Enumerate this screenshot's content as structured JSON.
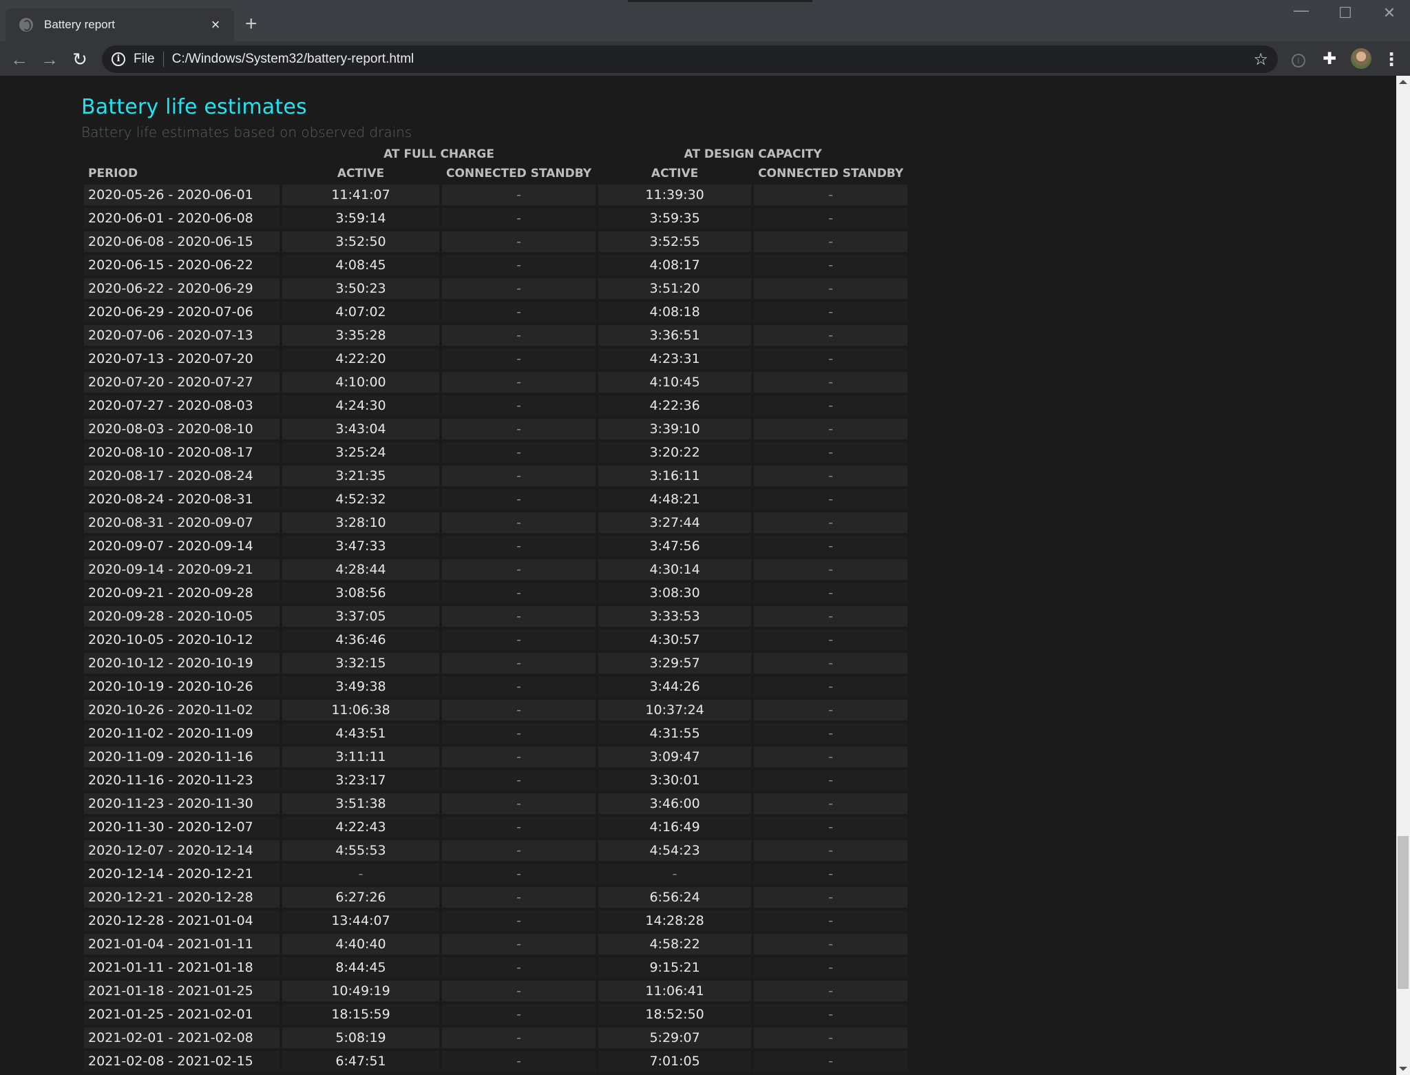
{
  "browser": {
    "tab_title": "Battery report",
    "tab_close": "×",
    "new_tab": "+",
    "window_controls": {
      "minimize": "—",
      "maximize": "☐",
      "close": "✕"
    },
    "nav": {
      "back": "←",
      "forward": "→",
      "reload": "↻"
    },
    "address": {
      "scheme_label": "File",
      "url": "C:/Windows/System32/battery-report.html",
      "info": "i"
    },
    "icons": {
      "star": "☆",
      "extension": "i",
      "puzzle": "✚",
      "menu": "⋮"
    }
  },
  "section": {
    "title": "Battery life estimates",
    "subtitle": "Battery life estimates based on observed drains"
  },
  "table": {
    "group_headers": [
      "AT FULL CHARGE",
      "AT DESIGN CAPACITY"
    ],
    "columns": [
      "PERIOD",
      "ACTIVE",
      "CONNECTED STANDBY",
      "ACTIVE",
      "CONNECTED STANDBY"
    ],
    "rows": [
      [
        "2020-05-26 - 2020-06-01",
        "11:41:07",
        "-",
        "11:39:30",
        "-"
      ],
      [
        "2020-06-01 - 2020-06-08",
        "3:59:14",
        "-",
        "3:59:35",
        "-"
      ],
      [
        "2020-06-08 - 2020-06-15",
        "3:52:50",
        "-",
        "3:52:55",
        "-"
      ],
      [
        "2020-06-15 - 2020-06-22",
        "4:08:45",
        "-",
        "4:08:17",
        "-"
      ],
      [
        "2020-06-22 - 2020-06-29",
        "3:50:23",
        "-",
        "3:51:20",
        "-"
      ],
      [
        "2020-06-29 - 2020-07-06",
        "4:07:02",
        "-",
        "4:08:18",
        "-"
      ],
      [
        "2020-07-06 - 2020-07-13",
        "3:35:28",
        "-",
        "3:36:51",
        "-"
      ],
      [
        "2020-07-13 - 2020-07-20",
        "4:22:20",
        "-",
        "4:23:31",
        "-"
      ],
      [
        "2020-07-20 - 2020-07-27",
        "4:10:00",
        "-",
        "4:10:45",
        "-"
      ],
      [
        "2020-07-27 - 2020-08-03",
        "4:24:30",
        "-",
        "4:22:36",
        "-"
      ],
      [
        "2020-08-03 - 2020-08-10",
        "3:43:04",
        "-",
        "3:39:10",
        "-"
      ],
      [
        "2020-08-10 - 2020-08-17",
        "3:25:24",
        "-",
        "3:20:22",
        "-"
      ],
      [
        "2020-08-17 - 2020-08-24",
        "3:21:35",
        "-",
        "3:16:11",
        "-"
      ],
      [
        "2020-08-24 - 2020-08-31",
        "4:52:32",
        "-",
        "4:48:21",
        "-"
      ],
      [
        "2020-08-31 - 2020-09-07",
        "3:28:10",
        "-",
        "3:27:44",
        "-"
      ],
      [
        "2020-09-07 - 2020-09-14",
        "3:47:33",
        "-",
        "3:47:56",
        "-"
      ],
      [
        "2020-09-14 - 2020-09-21",
        "4:28:44",
        "-",
        "4:30:14",
        "-"
      ],
      [
        "2020-09-21 - 2020-09-28",
        "3:08:56",
        "-",
        "3:08:30",
        "-"
      ],
      [
        "2020-09-28 - 2020-10-05",
        "3:37:05",
        "-",
        "3:33:53",
        "-"
      ],
      [
        "2020-10-05 - 2020-10-12",
        "4:36:46",
        "-",
        "4:30:57",
        "-"
      ],
      [
        "2020-10-12 - 2020-10-19",
        "3:32:15",
        "-",
        "3:29:57",
        "-"
      ],
      [
        "2020-10-19 - 2020-10-26",
        "3:49:38",
        "-",
        "3:44:26",
        "-"
      ],
      [
        "2020-10-26 - 2020-11-02",
        "11:06:38",
        "-",
        "10:37:24",
        "-"
      ],
      [
        "2020-11-02 - 2020-11-09",
        "4:43:51",
        "-",
        "4:31:55",
        "-"
      ],
      [
        "2020-11-09 - 2020-11-16",
        "3:11:11",
        "-",
        "3:09:47",
        "-"
      ],
      [
        "2020-11-16 - 2020-11-23",
        "3:23:17",
        "-",
        "3:30:01",
        "-"
      ],
      [
        "2020-11-23 - 2020-11-30",
        "3:51:38",
        "-",
        "3:46:00",
        "-"
      ],
      [
        "2020-11-30 - 2020-12-07",
        "4:22:43",
        "-",
        "4:16:49",
        "-"
      ],
      [
        "2020-12-07 - 2020-12-14",
        "4:55:53",
        "-",
        "4:54:23",
        "-"
      ],
      [
        "2020-12-14 - 2020-12-21",
        "-",
        "-",
        "-",
        "-"
      ],
      [
        "2020-12-21 - 2020-12-28",
        "6:27:26",
        "-",
        "6:56:24",
        "-"
      ],
      [
        "2020-12-28 - 2021-01-04",
        "13:44:07",
        "-",
        "14:28:28",
        "-"
      ],
      [
        "2021-01-04 - 2021-01-11",
        "4:40:40",
        "-",
        "4:58:22",
        "-"
      ],
      [
        "2021-01-11 - 2021-01-18",
        "8:44:45",
        "-",
        "9:15:21",
        "-"
      ],
      [
        "2021-01-18 - 2021-01-25",
        "10:49:19",
        "-",
        "11:06:41",
        "-"
      ],
      [
        "2021-01-25 - 2021-02-01",
        "18:15:59",
        "-",
        "18:52:50",
        "-"
      ],
      [
        "2021-02-01 - 2021-02-08",
        "5:08:19",
        "-",
        "5:29:07",
        "-"
      ],
      [
        "2021-02-08 - 2021-02-15",
        "6:47:51",
        "-",
        "7:01:05",
        "-"
      ]
    ]
  },
  "colors": {
    "title_accent": "#22e3f0",
    "page_bg": "#1b1b1b",
    "row_odd": "#262626",
    "row_even": "#1f1f1f"
  }
}
